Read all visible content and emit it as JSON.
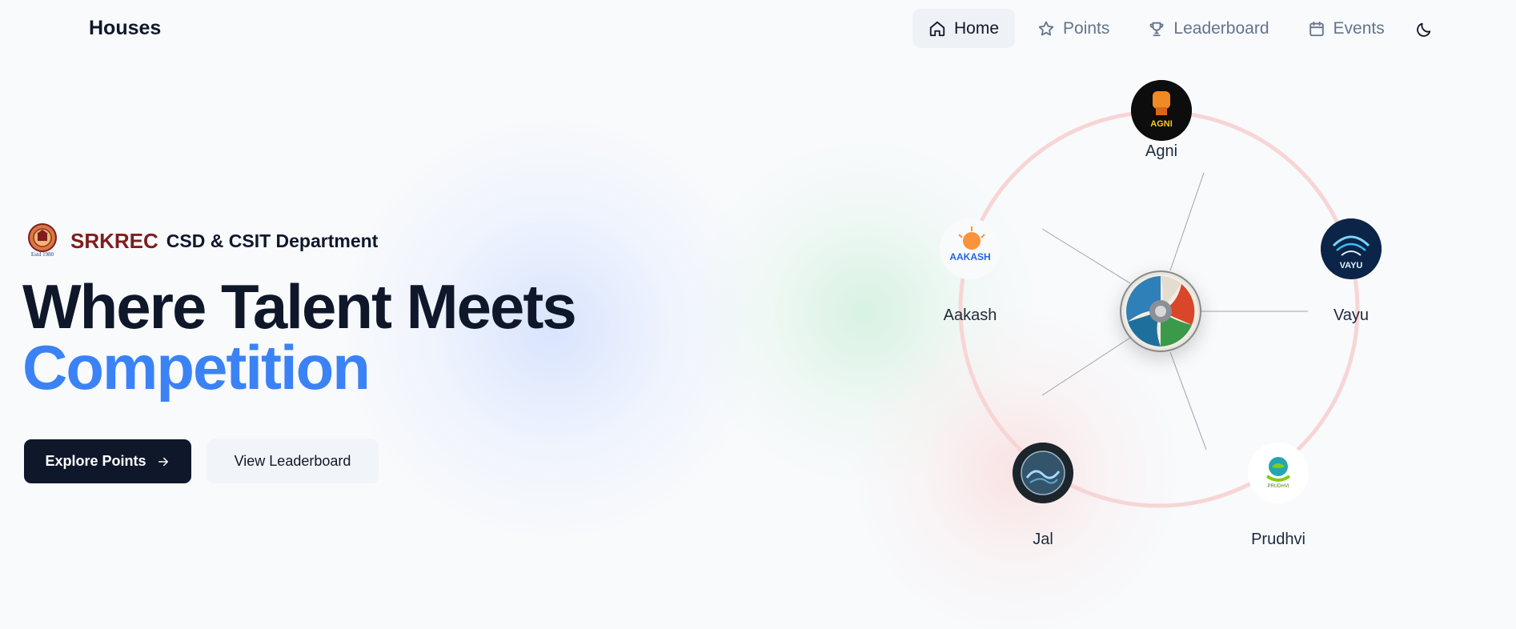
{
  "brand": {
    "title": "Houses"
  },
  "nav": {
    "items": [
      {
        "label": "Home",
        "icon": "home-icon",
        "active": true
      },
      {
        "label": "Points",
        "icon": "star-icon",
        "active": false
      },
      {
        "label": "Leaderboard",
        "icon": "trophy-icon",
        "active": false
      },
      {
        "label": "Events",
        "icon": "calendar-icon",
        "active": false
      }
    ],
    "theme_toggle_icon": "moon-icon"
  },
  "hero": {
    "dept_logo_text": "Estd 1980",
    "dept_short": "SRKREC",
    "dept_full": "CSD & CSIT Department",
    "title_line1": "Where Talent Meets",
    "title_line2": "Competition",
    "primary_button": "Explore Points",
    "secondary_button": "View Leaderboard"
  },
  "houses": [
    {
      "name": "Agni",
      "logo_text": "AGNI",
      "color": "#f97316"
    },
    {
      "name": "Vayu",
      "logo_text": "VAYU",
      "color": "#38bdf8"
    },
    {
      "name": "Prudhvi",
      "logo_text": "PRUDHVI",
      "color": "#84cc16"
    },
    {
      "name": "Jal",
      "logo_text": "",
      "color": "#0e7490"
    },
    {
      "name": "Aakash",
      "logo_text": "AAKASH",
      "color": "#fb923c"
    }
  ],
  "colors": {
    "accent": "#3b82f6",
    "dark": "#0f172a",
    "srkrec": "#7f1d1d",
    "ring": "#f9d4d4"
  }
}
